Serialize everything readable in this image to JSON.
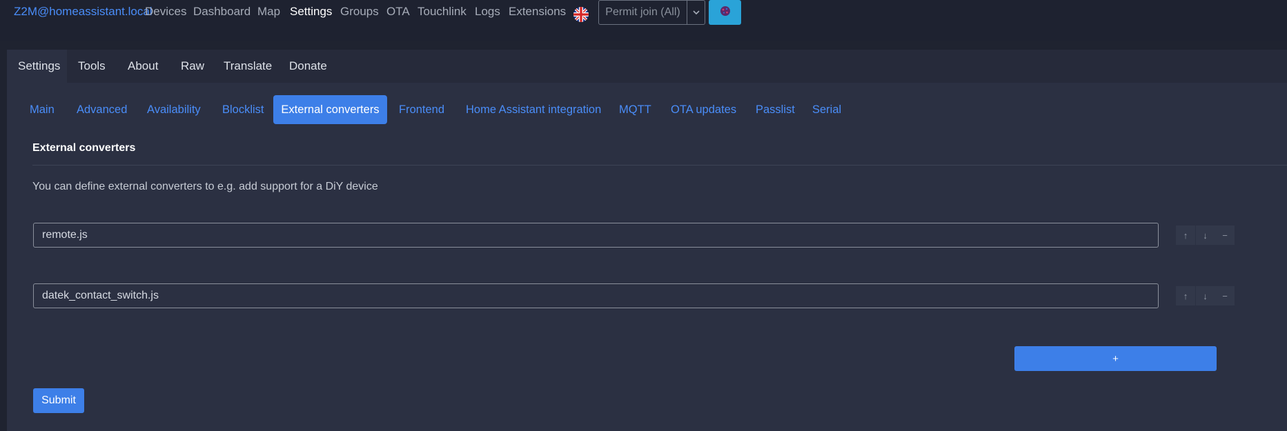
{
  "navbar": {
    "brand": "Z2M@homeassistant.local",
    "links": [
      {
        "label": "Devices",
        "active": false
      },
      {
        "label": "Dashboard",
        "active": false
      },
      {
        "label": "Map",
        "active": false
      },
      {
        "label": "Settings",
        "active": true
      },
      {
        "label": "Groups",
        "active": false
      },
      {
        "label": "OTA",
        "active": false
      },
      {
        "label": "Touchlink",
        "active": false
      },
      {
        "label": "Logs",
        "active": false
      },
      {
        "label": "Extensions",
        "active": false
      }
    ],
    "language_icon": "uk-flag-icon",
    "permit_join": {
      "label": "Permit join (All)"
    },
    "theme_icon": "theme-icon"
  },
  "tabs": [
    "Settings",
    "Tools",
    "About",
    "Raw",
    "Translate",
    "Donate"
  ],
  "active_tab": "Settings",
  "subtabs": [
    "Main",
    "Advanced",
    "Availability",
    "Blocklist",
    "External converters",
    "Frontend",
    "Home Assistant integration",
    "MQTT",
    "OTA updates",
    "Passlist",
    "Serial"
  ],
  "active_subtab": "External converters",
  "section": {
    "title": "External converters",
    "description": "You can define external converters to e.g. add support for a DiY device"
  },
  "items": [
    {
      "value": "remote.js"
    },
    {
      "value": "datek_contact_switch.js"
    }
  ],
  "item_buttons": {
    "up_icon": "arrow-up-icon",
    "down_icon": "arrow-down-icon",
    "remove_icon": "minus-icon",
    "up": "↑",
    "down": "↓",
    "remove": "−"
  },
  "add_button": {
    "label": "+"
  },
  "submit_button": {
    "label": "Submit"
  },
  "colors": {
    "accent": "#3d7fe8",
    "link": "#4a8df8",
    "background": "#1f2330",
    "card": "#2b3042",
    "theme_button": "#2aa3d8"
  }
}
